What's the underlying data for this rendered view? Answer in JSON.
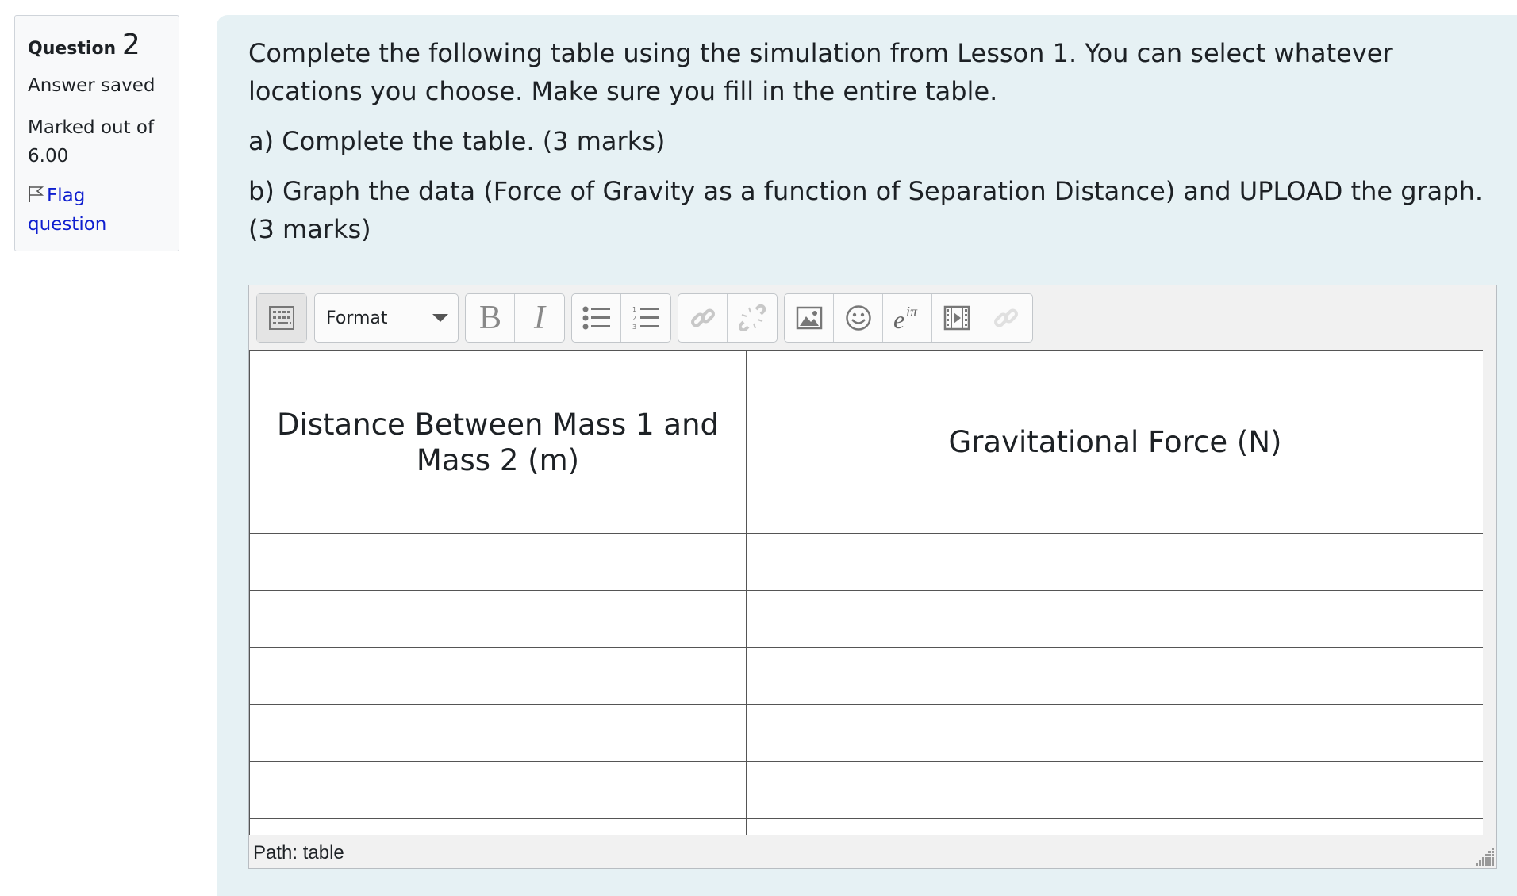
{
  "info": {
    "question_label": "Question",
    "question_number": "2",
    "state": "Answer saved",
    "grade": "Marked out of 6.00",
    "flag_label": "Flag question"
  },
  "question": {
    "intro": "Complete the following table using the simulation from Lesson 1.  You can select whatever locations you choose.  Make sure you fill in the entire table.",
    "part_a": "a)  Complete the table. (3 marks)",
    "part_b": "b)  Graph the data (Force of Gravity as a function of Separation Distance) and UPLOAD the graph. (3 marks)"
  },
  "editor": {
    "format_label": "Format",
    "toolbar_icons": [
      "toolbar-toggle-icon",
      "bold-icon",
      "italic-icon",
      "bullet-list-icon",
      "numbered-list-icon",
      "link-icon",
      "unlink-icon",
      "image-icon",
      "emoticon-icon",
      "equation-icon",
      "media-icon",
      "manage-files-icon"
    ],
    "table": {
      "headers": [
        "Distance Between Mass 1 and Mass 2 (m)",
        "Gravitational Force (N)"
      ],
      "rows": [
        [
          "",
          ""
        ],
        [
          "",
          ""
        ],
        [
          "",
          ""
        ],
        [
          "",
          ""
        ],
        [
          "",
          ""
        ],
        [
          "",
          ""
        ]
      ]
    },
    "path_label": "Path: table"
  }
}
